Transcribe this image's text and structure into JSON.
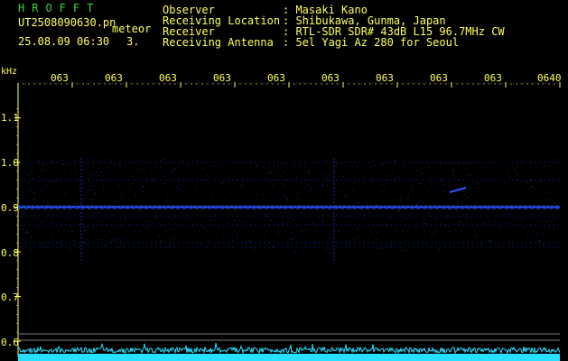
{
  "header": {
    "title": "HROFFT",
    "file_name": "UT2508090630.pn",
    "file_suffix": "meteor",
    "datetime": "25.08.09 06:30",
    "index": "3."
  },
  "meta": [
    {
      "key": "Observer",
      "value": ": Masaki Kano"
    },
    {
      "key": "Receiving Location",
      "value": ": Shibukawa, Gunma, Japan"
    },
    {
      "key": "Receiver",
      "value": ": RTL-SDR SDR# 43dB L15 96.7MHz CW"
    },
    {
      "key": "Receiving Antenna",
      "value": ": 5el Yagi Az 280 for Seoul"
    }
  ],
  "spectrogram": {
    "unit": "kHz",
    "time_ticks": [
      "063",
      "063",
      "063",
      "063",
      "063",
      "063",
      "063",
      "063",
      "063",
      "0640"
    ],
    "freq_ticks": [
      "1.1",
      "1.0",
      "0.9",
      "0.8",
      "0.7",
      "0.6"
    ],
    "freq_values": [
      1.1,
      1.0,
      0.9,
      0.8,
      0.7,
      0.6
    ],
    "carrier_freq": 0.9,
    "colors": {
      "background": "#000000",
      "signal": "#2a56ff",
      "ticks": "#ffff5a",
      "noise": "#27e0ff"
    }
  }
}
